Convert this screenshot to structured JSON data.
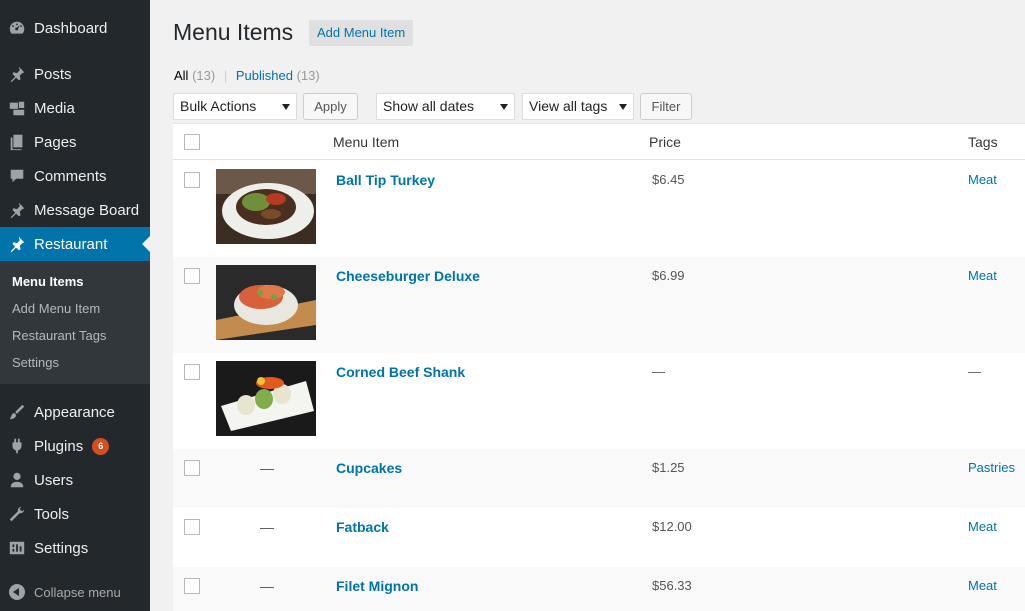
{
  "sidebar": {
    "items": [
      {
        "label": "Dashboard",
        "icon": "dashboard-icon"
      },
      {
        "label": "Posts",
        "icon": "pin-icon"
      },
      {
        "label": "Media",
        "icon": "media-icon"
      },
      {
        "label": "Pages",
        "icon": "pages-icon"
      },
      {
        "label": "Comments",
        "icon": "comment-icon"
      },
      {
        "label": "Message Board",
        "icon": "pin-icon"
      },
      {
        "label": "Restaurant",
        "icon": "pin-icon"
      },
      {
        "label": "Appearance",
        "icon": "brush-icon"
      },
      {
        "label": "Plugins",
        "icon": "plugin-icon",
        "badge": "6"
      },
      {
        "label": "Users",
        "icon": "user-icon"
      },
      {
        "label": "Tools",
        "icon": "wrench-icon"
      },
      {
        "label": "Settings",
        "icon": "settings-icon"
      }
    ],
    "submenu": [
      "Menu Items",
      "Add Menu Item",
      "Restaurant Tags",
      "Settings"
    ],
    "collapse_label": "Collapse menu",
    "accent": "#0073aa"
  },
  "header": {
    "title": "Menu Items",
    "add_label": "Add Menu Item"
  },
  "filters": {
    "all_label": "All",
    "all_count": "(13)",
    "published_label": "Published",
    "published_count": "(13)",
    "bulk": "Bulk Actions",
    "apply": "Apply",
    "dates": "Show all dates",
    "tags": "View all tags",
    "filter": "Filter"
  },
  "table": {
    "columns": {
      "item": "Menu Item",
      "price": "Price",
      "tags": "Tags"
    },
    "rows": [
      {
        "name": "Ball Tip Turkey",
        "price": "$6.45",
        "tag": "Meat",
        "thumb": "image"
      },
      {
        "name": "Cheeseburger Deluxe",
        "price": "$6.99",
        "tag": "Meat",
        "thumb": "image"
      },
      {
        "name": "Corned Beef Shank",
        "price": "—",
        "tag": "—",
        "thumb": "image"
      },
      {
        "name": "Cupcakes",
        "price": "$1.25",
        "tag": "Pastries",
        "thumb": "—"
      },
      {
        "name": "Fatback",
        "price": "$12.00",
        "tag": "Meat",
        "thumb": "—"
      },
      {
        "name": "Filet Mignon",
        "price": "$56.33",
        "tag": "Meat",
        "thumb": "—"
      }
    ]
  }
}
